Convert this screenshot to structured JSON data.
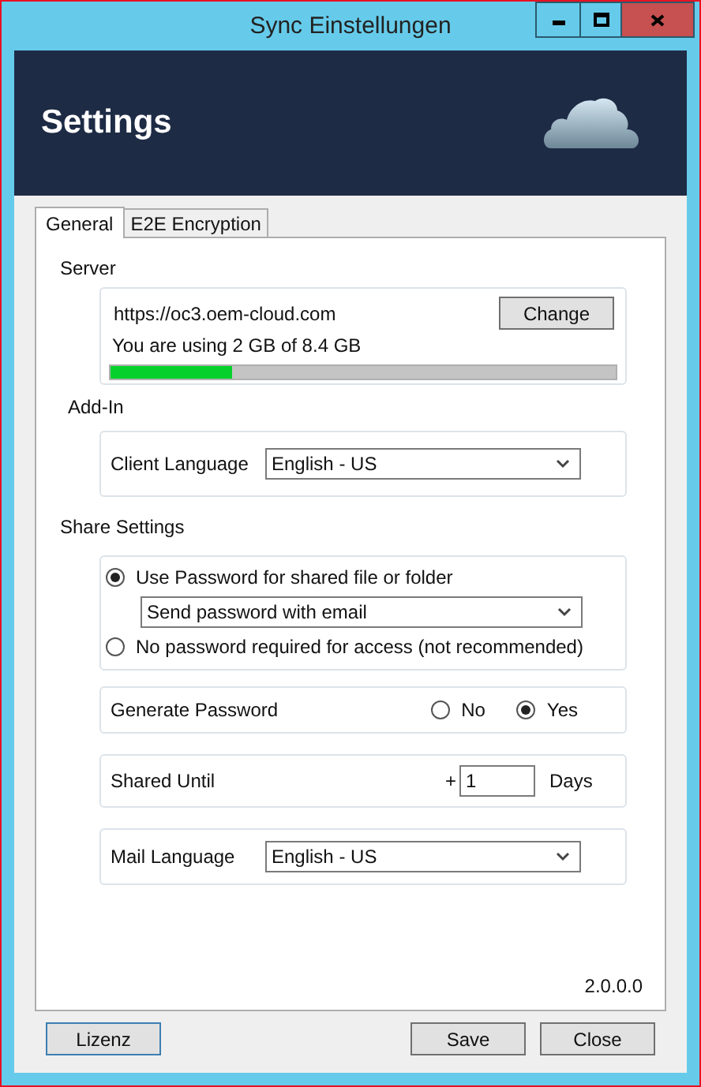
{
  "window": {
    "title": "Sync Einstellungen"
  },
  "header": {
    "title": "Settings"
  },
  "tabs": [
    {
      "label": "General",
      "selected": true
    },
    {
      "label": "E2E Encryption",
      "selected": false
    }
  ],
  "server": {
    "heading": "Server",
    "url": "https://oc3.oem-cloud.com",
    "change_button": "Change",
    "usage": "You are using 2 GB of 8.4 GB",
    "level": 0.24
  },
  "add_in": {
    "heading": "Add-In",
    "client_language": {
      "label": "Client Language",
      "value": "English - US"
    }
  },
  "share_settings": {
    "heading": "Share Settings",
    "password_options": [
      {
        "label": "Use Password for shared file or folder",
        "selected": true,
        "dropdown": "Send password with email"
      },
      {
        "label": "No password required for access (not recommended)",
        "selected": false
      }
    ],
    "generate_password": {
      "label": "Generate Password",
      "options": [
        {
          "label": "No",
          "selected": false
        },
        {
          "label": "Yes",
          "selected": true
        }
      ]
    },
    "shared_until": {
      "label": "Shared Until",
      "prefix": "+",
      "value": "1",
      "unit": "Days"
    },
    "mail_language": {
      "label": "Mail Language",
      "value": "English - US"
    }
  },
  "version": "2.0.0.0",
  "buttons": [
    {
      "label": "Lizenz"
    },
    {
      "label": "Save"
    },
    {
      "label": "Close"
    }
  ]
}
